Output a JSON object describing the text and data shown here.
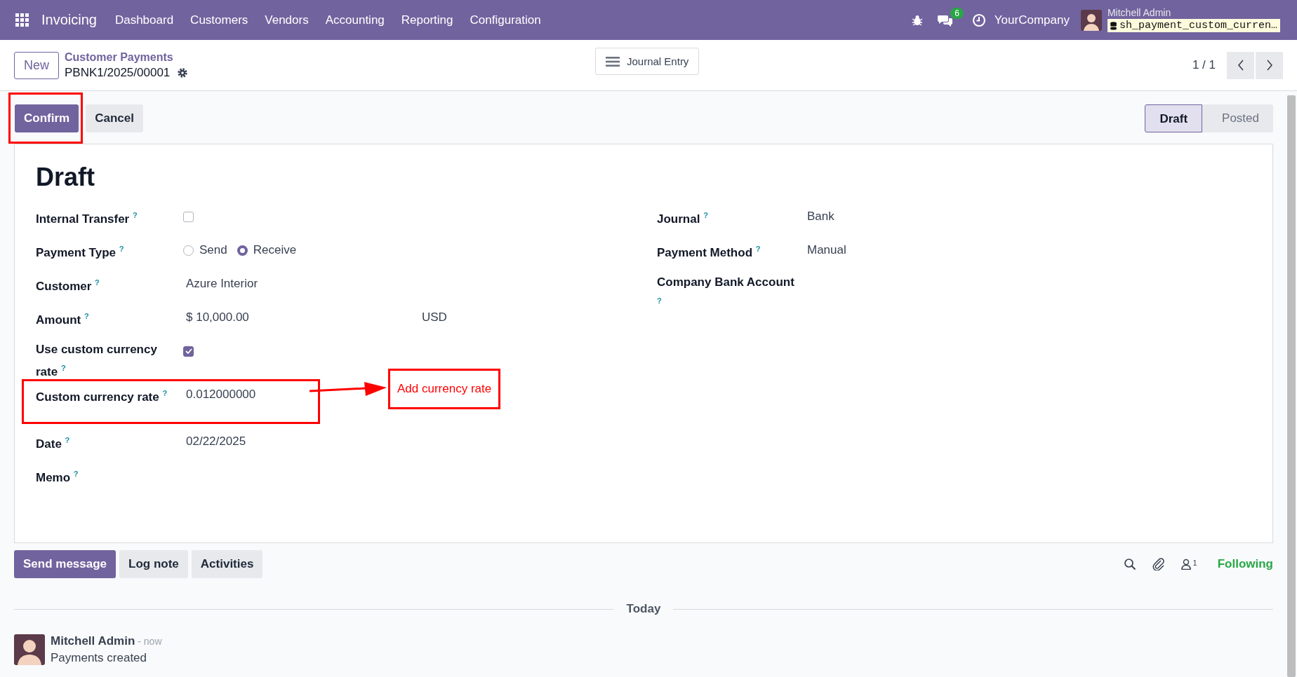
{
  "navbar": {
    "app": "Invoicing",
    "menus": [
      "Dashboard",
      "Customers",
      "Vendors",
      "Accounting",
      "Reporting",
      "Configuration"
    ],
    "chat_count": "6",
    "company": "YourCompany",
    "user": "Mitchell Admin",
    "database": "sh_payment_custom_curren…"
  },
  "control_panel": {
    "new_button": "New",
    "breadcrumb": "Customer Payments",
    "record": "PBNK1/2025/00001",
    "smart_button": "Journal Entry",
    "pager": "1 / 1"
  },
  "actions": [
    {
      "label": "Confirm",
      "kind": "primary",
      "highlighted": true
    },
    {
      "label": "Cancel",
      "kind": "secondary",
      "highlighted": false
    }
  ],
  "statusbar": [
    {
      "label": "Draft",
      "selected": true
    },
    {
      "label": "Posted",
      "selected": false
    }
  ],
  "form": {
    "title": "Draft",
    "left": [
      {
        "label": "Internal Transfer",
        "help": "?",
        "kind": "checkbox",
        "checked": false
      },
      {
        "label": "Payment Type",
        "help": "?",
        "kind": "radio",
        "options": [
          {
            "label": "Send",
            "selected": false
          },
          {
            "label": "Receive",
            "selected": true
          }
        ]
      },
      {
        "label": "Customer",
        "help": "?",
        "kind": "text",
        "value": "Azure Interior"
      },
      {
        "label": "Amount",
        "help": "?",
        "kind": "money",
        "value": "$ 10,000.00",
        "currency": "USD"
      },
      {
        "label": "Use custom currency rate",
        "help": "?",
        "kind": "checkbox",
        "checked": true
      },
      {
        "label": "Custom currency rate",
        "help": "?",
        "kind": "text",
        "value": "0.012000000",
        "highlighted": true,
        "annotation": "Add currency rate"
      },
      {
        "label": "Date",
        "help": "?",
        "kind": "text",
        "value": "02/22/2025"
      },
      {
        "label": "Memo",
        "help": "?",
        "kind": "text"
      }
    ],
    "right": [
      {
        "label": "Journal",
        "help": "?",
        "kind": "text",
        "value": "Bank"
      },
      {
        "label": "Payment Method",
        "help": "?",
        "kind": "text",
        "value": "Manual"
      },
      {
        "label": "Company Bank Account",
        "help": "?",
        "kind": "text"
      }
    ]
  },
  "chatter": {
    "buttons": [
      {
        "label": "Send message",
        "kind": "primary"
      },
      {
        "label": "Log note",
        "kind": "secondary"
      },
      {
        "label": "Activities",
        "kind": "secondary"
      }
    ],
    "follower_count": "1",
    "follow_label": "Following",
    "date_separator": "Today",
    "messages": [
      {
        "author": "Mitchell Admin",
        "time": "- now",
        "body": "Payments created"
      }
    ]
  }
}
